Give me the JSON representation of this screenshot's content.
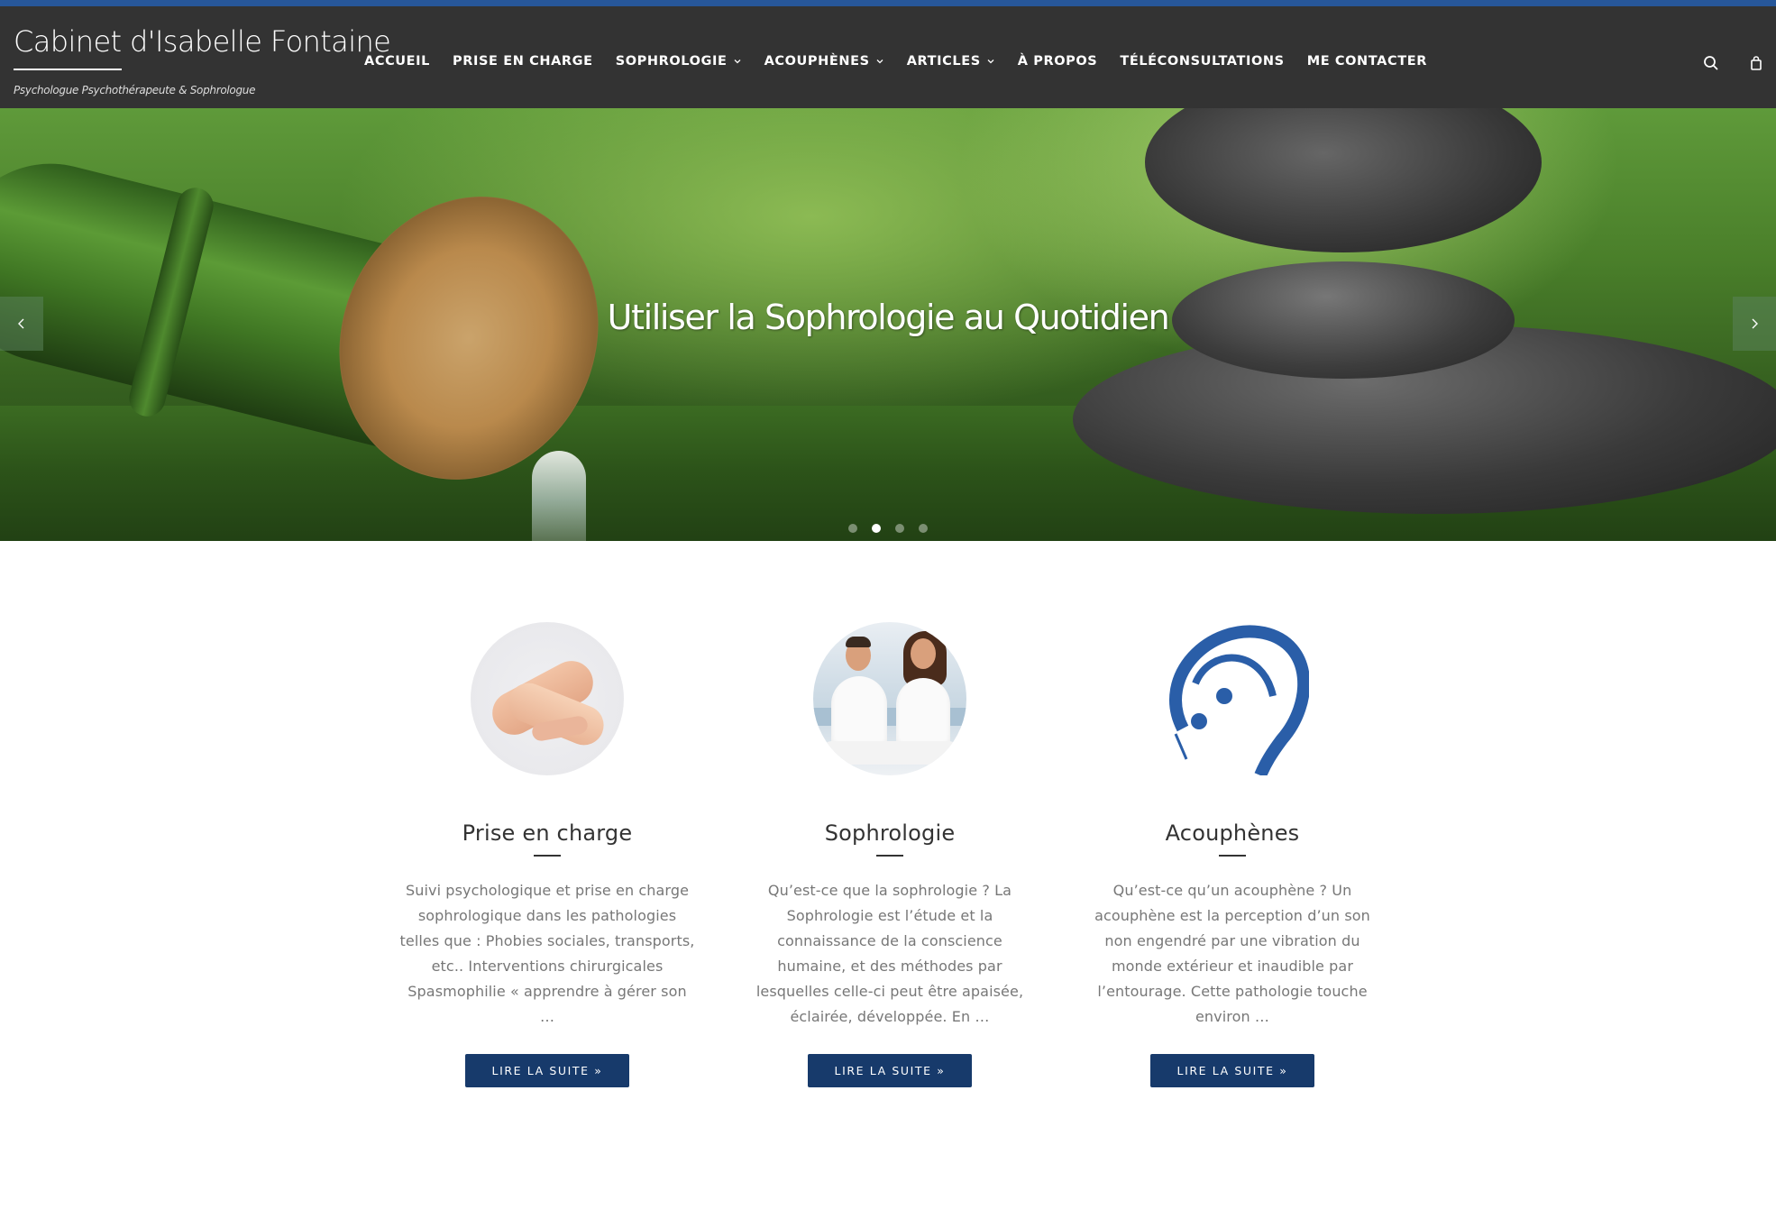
{
  "site": {
    "title": "Cabinet d'Isabelle Fontaine",
    "tagline": "Psychologue Psychothérapeute & Sophrologue"
  },
  "nav": {
    "items": [
      {
        "label": "ACCUEIL",
        "has_submenu": false
      },
      {
        "label": "PRISE EN CHARGE",
        "has_submenu": false
      },
      {
        "label": "SOPHROLOGIE",
        "has_submenu": true
      },
      {
        "label": "ACOUPHÈNES",
        "has_submenu": true
      },
      {
        "label": "ARTICLES",
        "has_submenu": true
      },
      {
        "label": "À PROPOS",
        "has_submenu": false
      },
      {
        "label": "TÉLÉCONSULTATIONS",
        "has_submenu": false
      },
      {
        "label": "ME CONTACTER",
        "has_submenu": false
      }
    ],
    "icons": [
      "search-icon",
      "shopping-bag-icon"
    ]
  },
  "hero": {
    "caption": "Utiliser la Sophrologie au Quotidien",
    "slide_count": 4,
    "active_slide": 2,
    "icons": [
      "chevron-left-icon",
      "chevron-right-icon"
    ]
  },
  "features": [
    {
      "title": "Prise en charge",
      "text": "Suivi psychologique et prise en charge sophrologique dans les pathologies telles que :   Phobies sociales, transports, etc.. Interventions chirurgicales Spasmophilie « apprendre à gérer son …",
      "button": "LIRE LA SUITE »"
    },
    {
      "title": "Sophrologie",
      "text": "Qu’est-ce que la sophrologie ?   La Sophrologie est l’étude et la connaissance de la conscience humaine, et des méthodes par lesquelles celle-ci peut être apaisée, éclairée, développée. En …",
      "button": "LIRE LA SUITE »"
    },
    {
      "title": "Acouphènes",
      "text": "Qu’est-ce qu’un acouphène ? Un acouphène est la perception d’un son non engendré par une vibration du monde extérieur et inaudible par l’entourage. Cette pathologie touche environ …",
      "button": "LIRE LA SUITE »"
    }
  ],
  "colors": {
    "accent_line": "#27579a",
    "header_bg": "#333333",
    "button_bg": "#173a6b",
    "ear_logo": "#2a5ea8"
  }
}
